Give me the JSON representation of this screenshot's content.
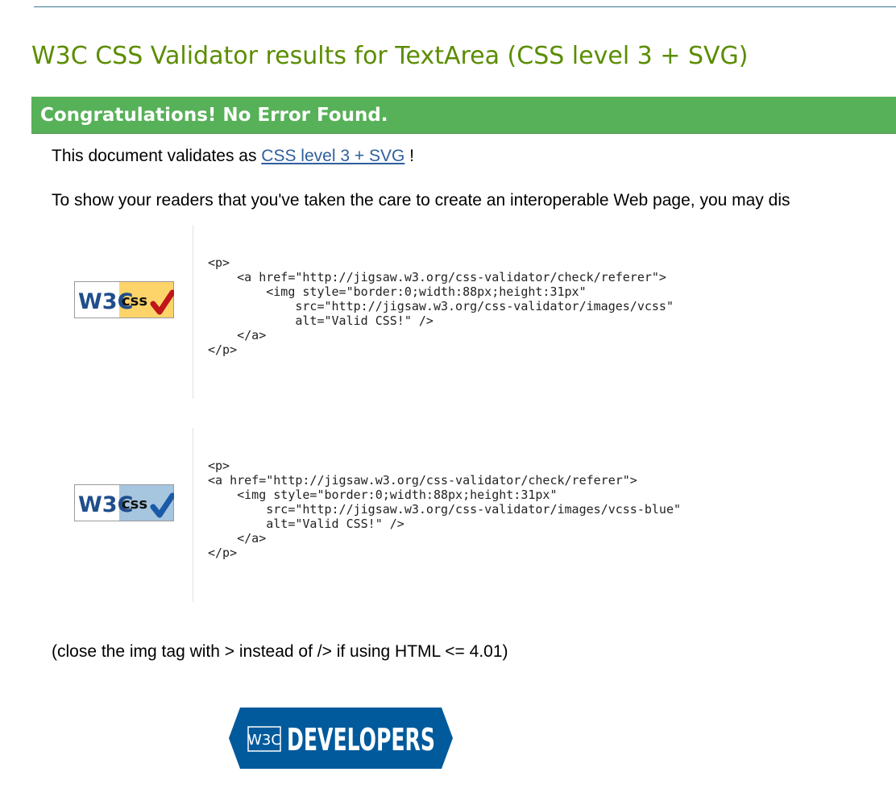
{
  "page": {
    "title": "W3C CSS Validator results for TextArea (CSS level 3 + SVG)"
  },
  "banner": {
    "text": "Congratulations! No Error Found.",
    "color": "#57b158"
  },
  "validates": {
    "prefix": "This document validates as ",
    "link_text": "CSS level 3 + SVG",
    "suffix": " !"
  },
  "readers_text": "To show your readers that you've taken the care to create an interoperable Web page, you may dis",
  "badges": [
    {
      "icon": "valid-css-badge-gold",
      "logo_text": "W3C",
      "label_text": "css",
      "color": "#fdd46a",
      "code": "<p>\n    <a href=\"http://jigsaw.w3.org/css-validator/check/referer\">\n        <img style=\"border:0;width:88px;height:31px\"\n            src=\"http://jigsaw.w3.org/css-validator/images/vcss\"\n            alt=\"Valid CSS!\" />\n    </a>\n</p>"
    },
    {
      "icon": "valid-css-badge-blue",
      "logo_text": "W3C",
      "label_text": "css",
      "color": "#a6c5df",
      "code": "<p>\n<a href=\"http://jigsaw.w3.org/css-validator/check/referer\">\n    <img style=\"border:0;width:88px;height:31px\"\n        src=\"http://jigsaw.w3.org/css-validator/images/vcss-blue\"\n        alt=\"Valid CSS!\" />\n    </a>\n</p>"
    }
  ],
  "note": "(close the img tag with > instead of /> if using HTML <= 4.01)",
  "developers_logo": {
    "icon": "w3c-developers-logo",
    "w3c_text": "W3C",
    "label": "DEVELOPERS",
    "color": "#005a9c"
  }
}
